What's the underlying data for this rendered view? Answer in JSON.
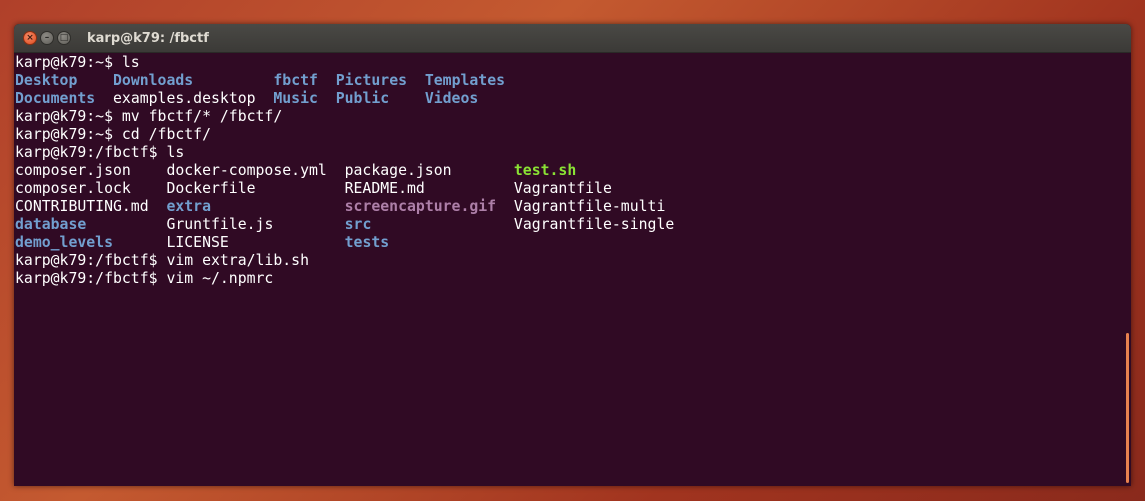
{
  "window": {
    "title": "karp@k79: /fbctf",
    "close_glyph": "×",
    "minimize_glyph": "–",
    "maximize_glyph": "□"
  },
  "colors": {
    "background": "#300a24",
    "text": "#ffffff",
    "directory": "#729fcf",
    "executable": "#8ae234",
    "image": "#ad7fa8",
    "scrollbar": "#e9824f"
  },
  "terminal": {
    "lines": [
      [
        {
          "text": "karp@k79:~$ ls",
          "type": "plain"
        }
      ],
      [
        {
          "text": "Desktop",
          "type": "dir"
        },
        {
          "text": "    ",
          "type": "plain"
        },
        {
          "text": "Downloads",
          "type": "dir"
        },
        {
          "text": "         ",
          "type": "plain"
        },
        {
          "text": "fbctf",
          "type": "dir"
        },
        {
          "text": "  ",
          "type": "plain"
        },
        {
          "text": "Pictures",
          "type": "dir"
        },
        {
          "text": "  ",
          "type": "plain"
        },
        {
          "text": "Templates",
          "type": "dir"
        }
      ],
      [
        {
          "text": "Documents",
          "type": "dir"
        },
        {
          "text": "  examples.desktop  ",
          "type": "plain"
        },
        {
          "text": "Music",
          "type": "dir"
        },
        {
          "text": "  ",
          "type": "plain"
        },
        {
          "text": "Public",
          "type": "dir"
        },
        {
          "text": "    ",
          "type": "plain"
        },
        {
          "text": "Videos",
          "type": "dir"
        }
      ],
      [
        {
          "text": "karp@k79:~$ mv fbctf/* /fbctf/",
          "type": "plain"
        }
      ],
      [
        {
          "text": "karp@k79:~$ cd /fbctf/",
          "type": "plain"
        }
      ],
      [
        {
          "text": "karp@k79:/fbctf$ ls",
          "type": "plain"
        }
      ],
      [
        {
          "text": "composer.json    docker-compose.yml  package.json       ",
          "type": "plain"
        },
        {
          "text": "test.sh",
          "type": "exec"
        }
      ],
      [
        {
          "text": "composer.lock    Dockerfile          README.md          Vagrantfile",
          "type": "plain"
        }
      ],
      [
        {
          "text": "CONTRIBUTING.md  ",
          "type": "plain"
        },
        {
          "text": "extra",
          "type": "dir"
        },
        {
          "text": "               ",
          "type": "plain"
        },
        {
          "text": "screencapture.gif",
          "type": "img"
        },
        {
          "text": "  Vagrantfile-multi",
          "type": "plain"
        }
      ],
      [
        {
          "text": "database",
          "type": "dir"
        },
        {
          "text": "         Gruntfile.js        ",
          "type": "plain"
        },
        {
          "text": "src",
          "type": "dir"
        },
        {
          "text": "                Vagrantfile-single",
          "type": "plain"
        }
      ],
      [
        {
          "text": "demo_levels",
          "type": "dir"
        },
        {
          "text": "      LICENSE             ",
          "type": "plain"
        },
        {
          "text": "tests",
          "type": "dir"
        }
      ],
      [
        {
          "text": "karp@k79:/fbctf$ vim extra/lib.sh",
          "type": "plain"
        }
      ],
      [
        {
          "text": "karp@k79:/fbctf$ vim ~/.npmrc",
          "type": "plain"
        }
      ]
    ]
  }
}
